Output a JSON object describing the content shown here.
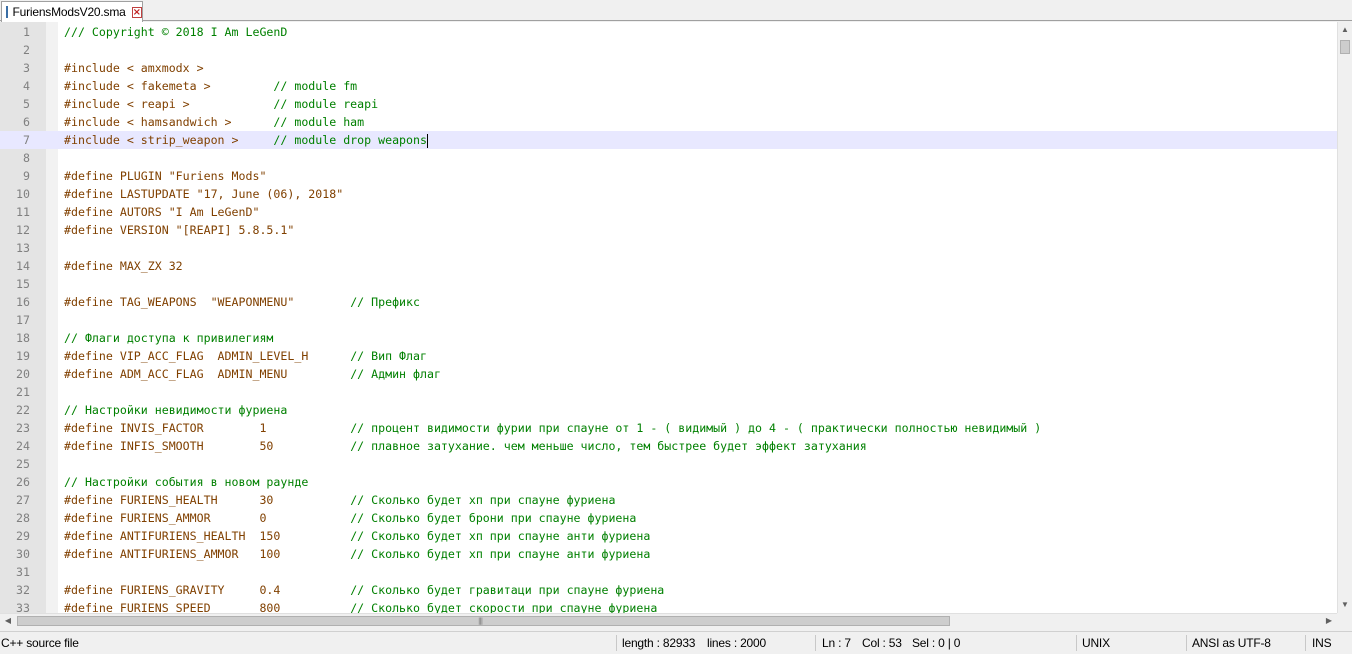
{
  "tab": {
    "file_name": "FuriensModsV20.sma",
    "file_icon": "file-icon",
    "close_icon": "close-icon"
  },
  "editor": {
    "current_line": 7,
    "lines": [
      {
        "n": "1",
        "t": "/// Copyright © 2018 I Am LeGenD",
        "k": "cm"
      },
      {
        "n": "2",
        "t": "",
        "k": ""
      },
      {
        "n": "3",
        "t": "#include < amxmodx >",
        "k": "pp"
      },
      {
        "n": "4",
        "t": "#include < fakemeta >         ",
        "k": "pp",
        "c": "// module fm"
      },
      {
        "n": "5",
        "t": "#include < reapi >            ",
        "k": "pp",
        "c": "// module reapi"
      },
      {
        "n": "6",
        "t": "#include < hamsandwich >      ",
        "k": "pp",
        "c": "// module ham"
      },
      {
        "n": "7",
        "t": "#include < strip_weapon >     ",
        "k": "pp",
        "c": "// module drop weapons"
      },
      {
        "n": "8",
        "t": "",
        "k": ""
      },
      {
        "n": "9",
        "t": "#define PLUGIN \"Furiens Mods\"",
        "k": "pp"
      },
      {
        "n": "10",
        "t": "#define LASTUPDATE \"17, June (06), 2018\"",
        "k": "pp"
      },
      {
        "n": "11",
        "t": "#define AUTORS \"I Am LeGenD\"",
        "k": "pp"
      },
      {
        "n": "12",
        "t": "#define VERSION \"[REAPI] 5.8.5.1\"",
        "k": "pp"
      },
      {
        "n": "13",
        "t": "",
        "k": ""
      },
      {
        "n": "14",
        "t": "#define MAX_ZX 32",
        "k": "pp"
      },
      {
        "n": "15",
        "t": "",
        "k": ""
      },
      {
        "n": "16",
        "t": "#define TAG_WEAPONS  \"WEAPONMENU\"        ",
        "k": "pp",
        "c": "// Префикс"
      },
      {
        "n": "17",
        "t": "",
        "k": ""
      },
      {
        "n": "18",
        "t": "// Флаги доступа к привилегиям",
        "k": "cm"
      },
      {
        "n": "19",
        "t": "#define VIP_ACC_FLAG  ADMIN_LEVEL_H      ",
        "k": "pp",
        "c": "// Вип Флаг"
      },
      {
        "n": "20",
        "t": "#define ADM_ACC_FLAG  ADMIN_MENU         ",
        "k": "pp",
        "c": "// Админ флаг"
      },
      {
        "n": "21",
        "t": "",
        "k": ""
      },
      {
        "n": "22",
        "t": "// Настройки невидимости фуриена",
        "k": "cm"
      },
      {
        "n": "23",
        "t": "#define INVIS_FACTOR        1            ",
        "k": "pp",
        "c": "// процент видимости фурии при спауне от 1 - ( видимый ) до 4 - ( практически полностью невидимый )"
      },
      {
        "n": "24",
        "t": "#define INFIS_SMOOTH        50           ",
        "k": "pp",
        "c": "// плавное затухание. чем меньше число, тем быстрее будет эффект затухания"
      },
      {
        "n": "25",
        "t": "",
        "k": ""
      },
      {
        "n": "26",
        "t": "// Настройки события в новом раунде",
        "k": "cm"
      },
      {
        "n": "27",
        "t": "#define FURIENS_HEALTH      30           ",
        "k": "pp",
        "c": "// Сколько будет хп при спауне фуриена"
      },
      {
        "n": "28",
        "t": "#define FURIENS_AMMOR       0            ",
        "k": "pp",
        "c": "// Сколько будет брони при спауне фуриена"
      },
      {
        "n": "29",
        "t": "#define ANTIFURIENS_HEALTH  150          ",
        "k": "pp",
        "c": "// Сколько будет хп при спауне анти фуриена"
      },
      {
        "n": "30",
        "t": "#define ANTIFURIENS_AMMOR   100          ",
        "k": "pp",
        "c": "// Сколько будет хп при спауне анти фуриена"
      },
      {
        "n": "31",
        "t": "",
        "k": ""
      },
      {
        "n": "32",
        "t": "#define FURIENS_GRAVITY     0.4          ",
        "k": "pp",
        "c": "// Сколько будет гравитаци при спауне фуриена"
      },
      {
        "n": "33",
        "t": "#define FURIENS_SPEED       800          ",
        "k": "pp",
        "c": "// Сколько будет скорости при спауне фуриена"
      }
    ]
  },
  "status": {
    "language": "C++ source file",
    "length": "length : 82933",
    "lines": "lines : 2000",
    "ln": "Ln : 7",
    "col": "Col : 53",
    "sel": "Sel : 0 | 0",
    "eol": "UNIX",
    "encoding": "ANSI as UTF-8",
    "mode": "INS"
  },
  "colors": {
    "comment": "#008000",
    "preprocessor": "#804000",
    "current_line": "#e8e8ff",
    "gutter": "#e4e4e4"
  }
}
